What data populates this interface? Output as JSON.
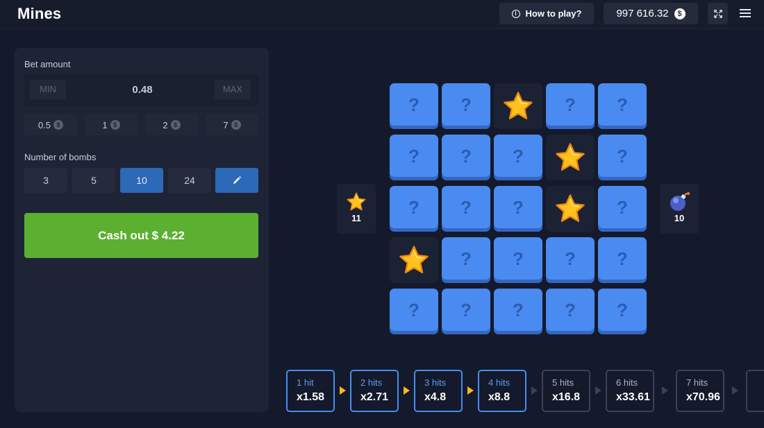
{
  "header": {
    "title": "Mines",
    "how_to_play": "How to play?",
    "balance": "997 616.32",
    "currency_symbol": "$",
    "icons": [
      "info-icon",
      "dollar-coin-icon",
      "fullscreen-icon",
      "menu-icon"
    ]
  },
  "panel": {
    "bet_label": "Bet amount",
    "min_label": "MIN",
    "max_label": "MAX",
    "bet_value": "0.48",
    "chips": [
      {
        "value": "0.5",
        "coin": "$"
      },
      {
        "value": "1",
        "coin": "$"
      },
      {
        "value": "2",
        "coin": "$"
      },
      {
        "value": "7",
        "coin": "$"
      }
    ],
    "bombs_label": "Number of bombs",
    "bomb_options": [
      "3",
      "5",
      "10",
      "24"
    ],
    "selected_bombs": "10",
    "edit_icon": "pencil-icon",
    "cashout_label": "Cash out $ 4.22"
  },
  "board": {
    "rows": 5,
    "cols": 5,
    "hidden_symbol": "?",
    "revealed": [
      {
        "row": 1,
        "col": 3,
        "content": "star"
      },
      {
        "row": 2,
        "col": 4,
        "content": "star"
      },
      {
        "row": 3,
        "col": 4,
        "content": "star"
      },
      {
        "row": 4,
        "col": 1,
        "content": "star"
      }
    ]
  },
  "counters": {
    "stars_left": "11",
    "bombs": "10",
    "star_icon": "star-icon",
    "bomb_icon": "bomb-icon"
  },
  "multipliers": [
    {
      "hits": "1 hit",
      "value": "x1.58",
      "state": "hit"
    },
    {
      "hits": "2 hits",
      "value": "x2.71",
      "state": "hit"
    },
    {
      "hits": "3 hits",
      "value": "x4.8",
      "state": "hit"
    },
    {
      "hits": "4 hits",
      "value": "x8.8",
      "state": "hit"
    },
    {
      "hits": "5 hits",
      "value": "x16.8",
      "state": "pending"
    },
    {
      "hits": "6 hits",
      "value": "x33.61",
      "state": "pending"
    },
    {
      "hits": "7 hits",
      "value": "x70.96",
      "state": "pending"
    }
  ],
  "colors": {
    "background": "#141a2b",
    "panel": "#1e2436",
    "tile": "#4a8bf2",
    "accent_blue": "#2c69b6",
    "cashout_green": "#5bb02f",
    "arrow_gold": "#f7b821"
  }
}
